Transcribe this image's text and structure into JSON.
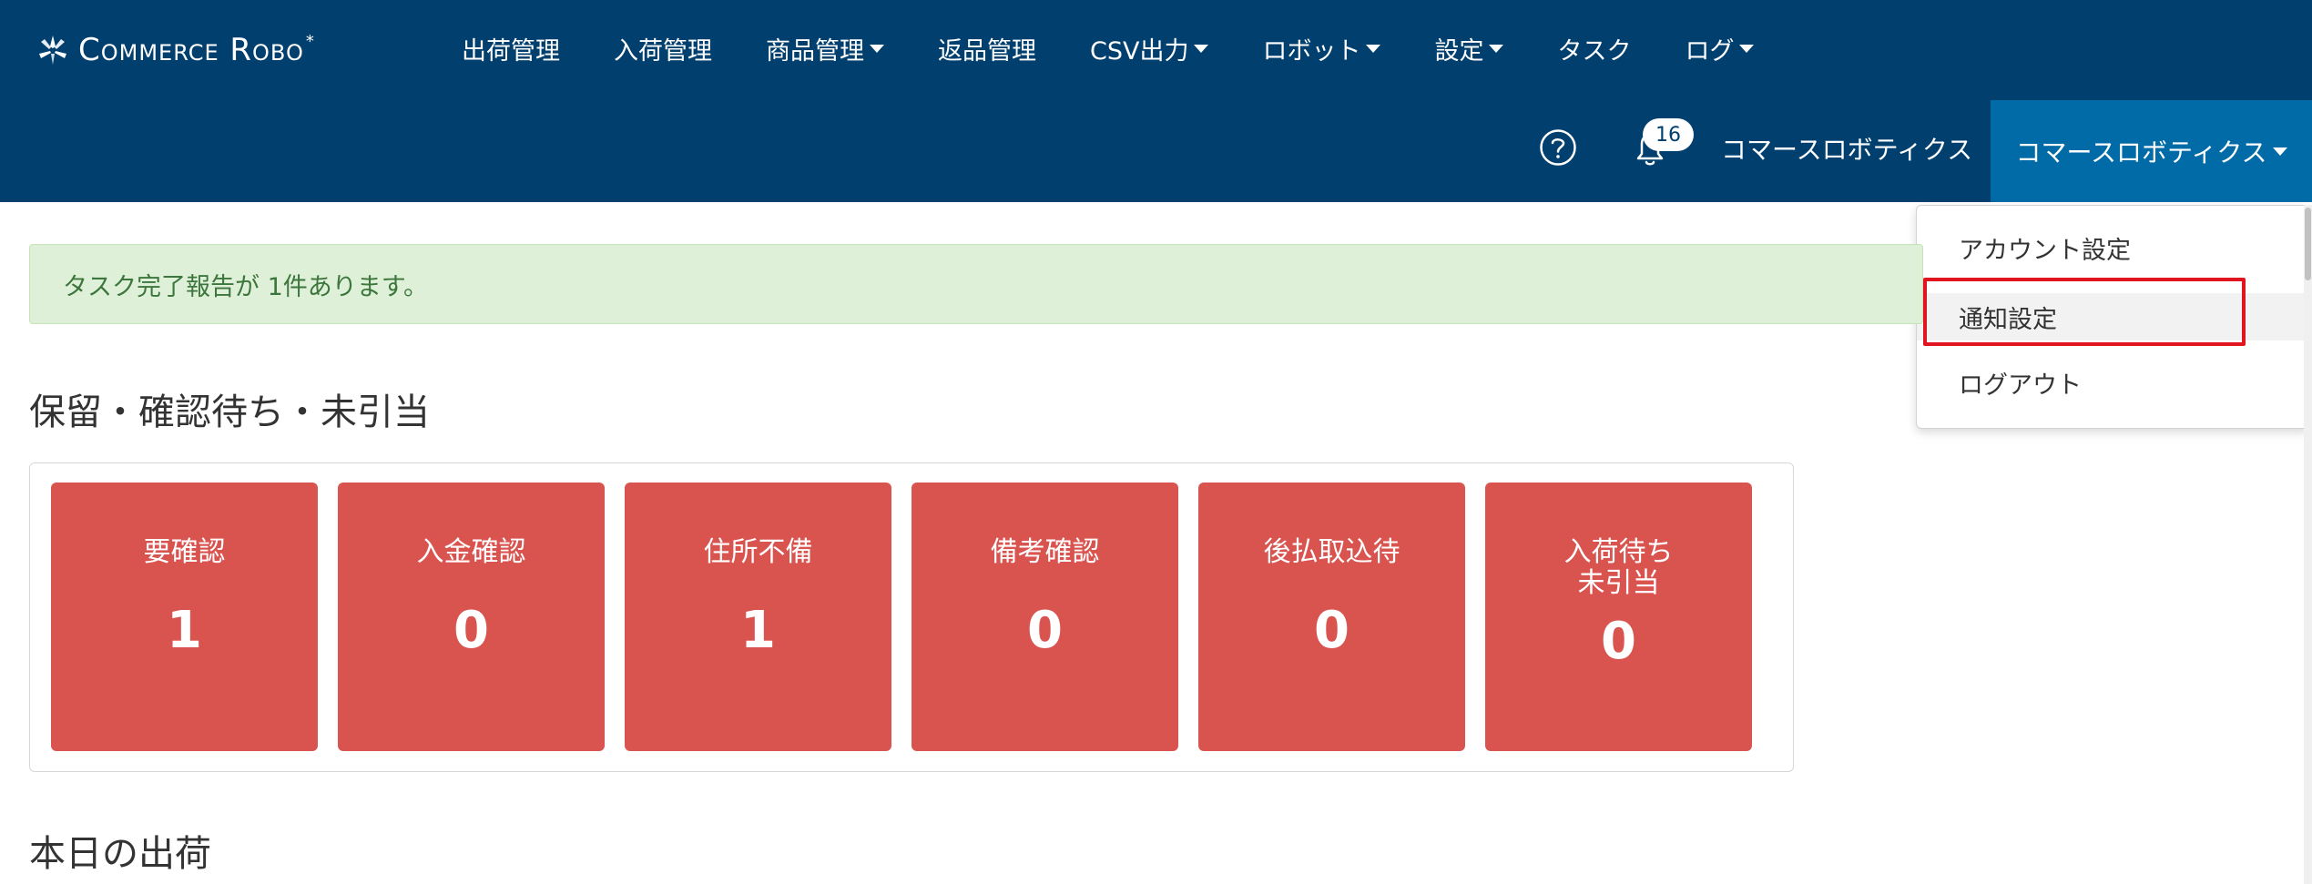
{
  "brand": {
    "name": "Commerce Robo",
    "star": "*"
  },
  "nav": {
    "items": [
      {
        "label": "出荷管理",
        "dropdown": false
      },
      {
        "label": "入荷管理",
        "dropdown": false
      },
      {
        "label": "商品管理",
        "dropdown": true
      },
      {
        "label": "返品管理",
        "dropdown": false
      },
      {
        "label": "CSV出力",
        "dropdown": true
      },
      {
        "label": "ロボット",
        "dropdown": true
      },
      {
        "label": "設定",
        "dropdown": true
      },
      {
        "label": "タスク",
        "dropdown": false
      },
      {
        "label": "ログ",
        "dropdown": true
      }
    ]
  },
  "header_right": {
    "notification_count": "16",
    "user_link": "コマースロボティクス",
    "user_dropdown": "コマースロボティクス"
  },
  "user_menu": {
    "items": [
      "アカウント設定",
      "通知設定",
      "ログアウト"
    ]
  },
  "alert": {
    "text": "タスク完了報告が 1件あります。"
  },
  "sections": {
    "hold_title": "保留・確認待ち・未引当",
    "today_title": "本日の出荷"
  },
  "cards": [
    {
      "label": "要確認",
      "value": "1"
    },
    {
      "label": "入金確認",
      "value": "0"
    },
    {
      "label": "住所不備",
      "value": "1"
    },
    {
      "label": "備考確認",
      "value": "0"
    },
    {
      "label": "後払取込待",
      "value": "0"
    },
    {
      "label": "入荷待ち\n未引当",
      "value": "0"
    }
  ],
  "colors": {
    "header": "#003f6e",
    "dropdown_active": "#006ba7",
    "card": "#d9534f",
    "alert_bg": "#dff0d8",
    "highlight": "#e1151f"
  }
}
